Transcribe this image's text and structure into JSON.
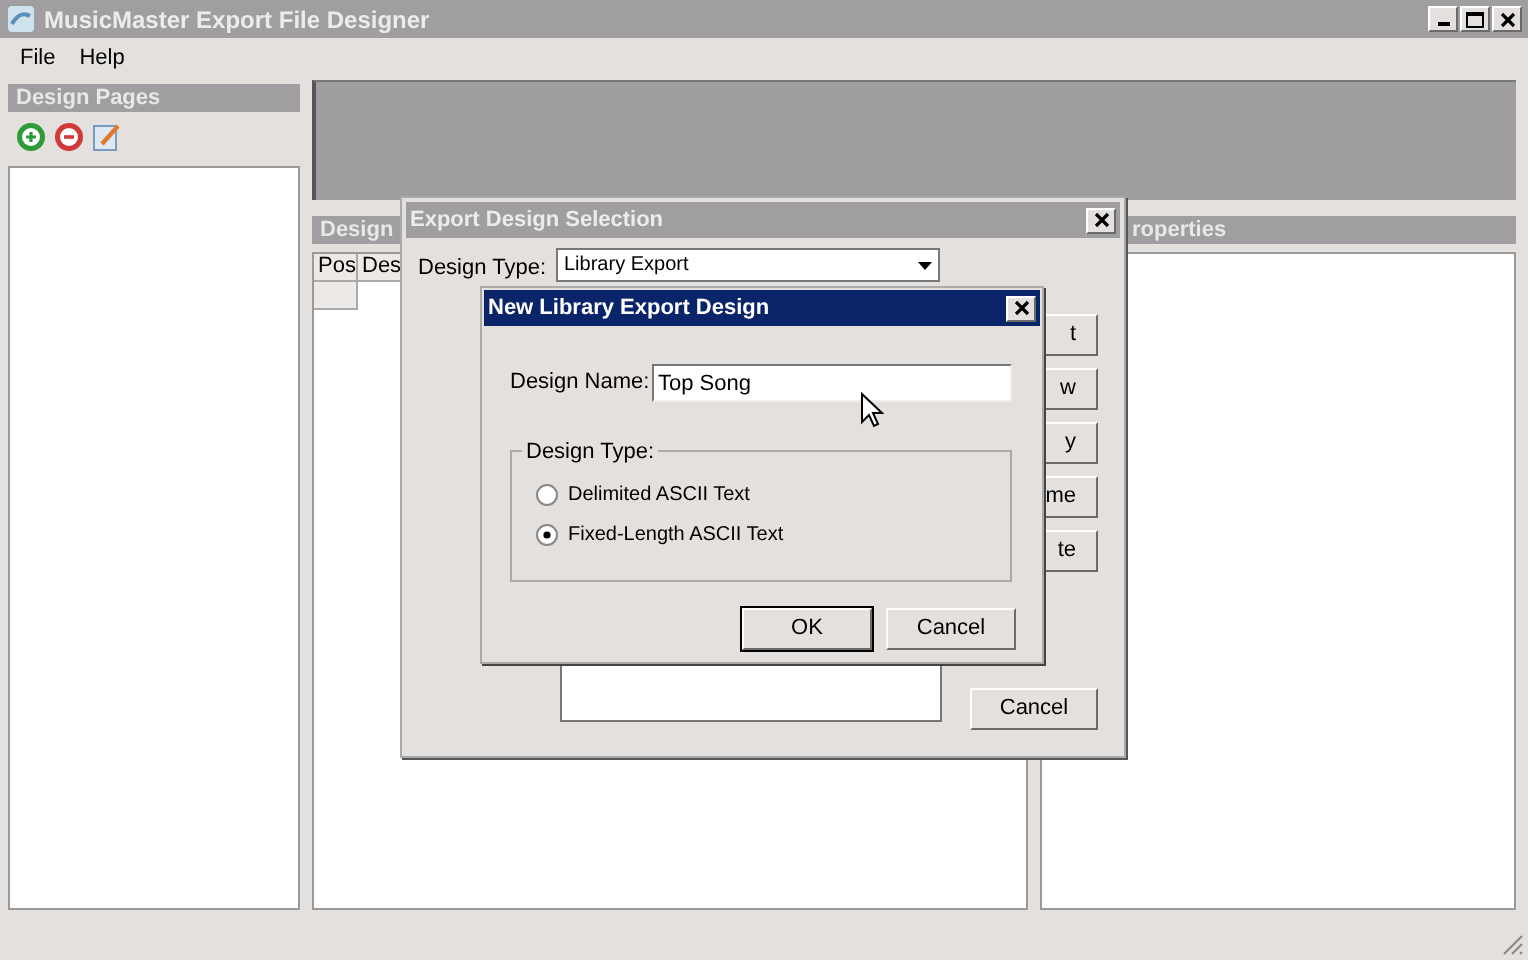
{
  "window": {
    "title": "MusicMaster Export File Designer"
  },
  "menu": [
    {
      "label": "File"
    },
    {
      "label": "Help"
    }
  ],
  "design_pages": {
    "title": "Design Pages"
  },
  "design_panel": {
    "title": "Design",
    "columns": [
      "Pos",
      "Des"
    ]
  },
  "properties_panel": {
    "title": "roperties"
  },
  "selection_dialog": {
    "title": "Export Design Selection",
    "design_type_label": "Design Type:",
    "design_type_value": "Library Export",
    "side_buttons": [
      "t",
      "w",
      "y",
      "me",
      "te"
    ],
    "cancel": "Cancel"
  },
  "new_design_dialog": {
    "title": "New Library Export Design",
    "name_label": "Design Name:",
    "name_value": "Top Song",
    "group_title": "Design Type:",
    "options": [
      {
        "label": "Delimited ASCII Text",
        "selected": false
      },
      {
        "label": "Fixed-Length ASCII Text",
        "selected": true
      }
    ],
    "buttons": [
      {
        "label": "OK",
        "default": true
      },
      {
        "label": "Cancel",
        "default": false
      }
    ]
  }
}
